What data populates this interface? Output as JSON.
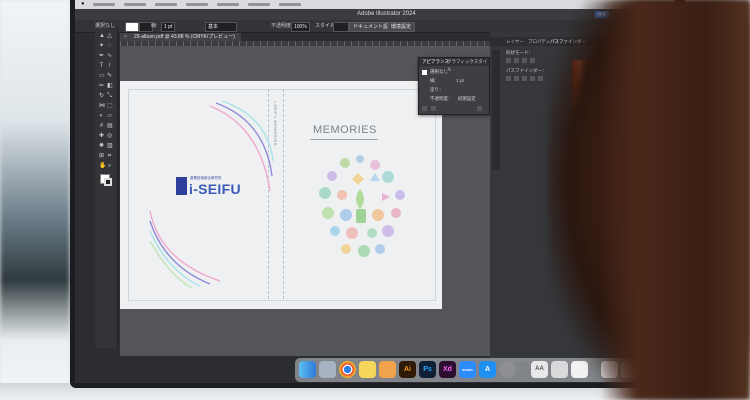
{
  "app": {
    "title": "Adobe Illustrator 2024",
    "share_label": "共有"
  },
  "toolbar": {
    "selection_label": "選択なし",
    "stroke_label": "線:",
    "stroke_value": "1 pt",
    "brush_value": "基本",
    "opacity_label": "不透明度:",
    "opacity_value": "100%",
    "style_label": "スタイル:",
    "doc_setup_label": "ドキュメント設定",
    "prefs_label": "環境設定"
  },
  "document": {
    "tab_label": "29-album.pdf @ 43.88 % (CMYK/プレビュー)"
  },
  "artboard": {
    "logo_small": "産業技術総合研究所",
    "logo_main": "i-SEIFU",
    "memories": "MEMORIES",
    "spine_text": "i-SEIFU MEMORIES"
  },
  "appearance_panel": {
    "tabs": [
      "アピアランス",
      "グラフィックスタイル"
    ],
    "title_row": "選択なし",
    "stroke_row": "線：",
    "stroke_value": "1 pt",
    "fill_row": "塗り：",
    "opacity_row": "不透明度：",
    "opacity_value": "初期設定"
  },
  "right_panel": {
    "tabs": [
      "レイヤー",
      "プロパティ",
      "パスファインダー",
      "カラー"
    ],
    "shape_mode_label": "形状モード：",
    "pathfinder_label": "パスファインダー："
  },
  "dock": {
    "icons": [
      "finder-icon",
      "launchpad-icon",
      "chrome-icon",
      "notes-icon",
      "pages-icon",
      "illustrator-icon",
      "photoshop-icon",
      "xd-icon",
      "zoom-icon",
      "appstore-icon",
      "settings-icon",
      "font-icon",
      "preview-icon",
      "script-icon",
      "files-icon",
      "trash-icon"
    ],
    "labels": {
      "illustrator": "Ai",
      "photoshop": "Ps",
      "xd": "Xd",
      "zoom": "zoom",
      "font": "AA"
    }
  }
}
